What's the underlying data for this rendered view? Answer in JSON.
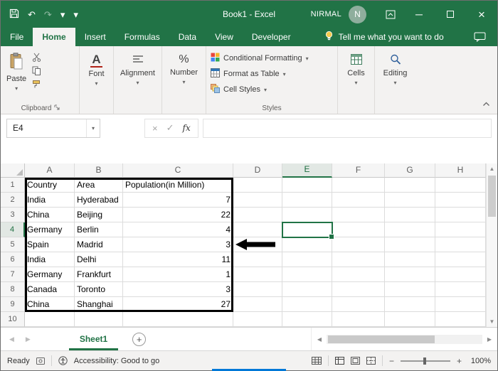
{
  "titlebar": {
    "title": "Book1 - Excel",
    "user_name": "NIRMAL",
    "avatar_initial": "N"
  },
  "tabs": [
    "File",
    "Home",
    "Insert",
    "Formulas",
    "Data",
    "View",
    "Developer"
  ],
  "tell_me_label": "Tell me what you want to do",
  "ribbon": {
    "paste_label": "Paste",
    "clipboard_group_label": "Clipboard",
    "font_label": "Font",
    "alignment_label": "Alignment",
    "number_label": "Number",
    "conditional_formatting_label": "Conditional Formatting",
    "format_as_table_label": "Format as Table",
    "cell_styles_label": "Cell Styles",
    "styles_group_label": "Styles",
    "cells_label": "Cells",
    "editing_label": "Editing"
  },
  "formula_bar": {
    "name_box_value": "E4",
    "fx_label": "fx",
    "formula_value": ""
  },
  "grid": {
    "column_headers": [
      "A",
      "B",
      "C",
      "D",
      "E",
      "F",
      "G",
      "H"
    ],
    "selected_cell": "E4",
    "selected_column": "E",
    "selected_row": 4,
    "row_count": 10,
    "table": {
      "headers": [
        "Country",
        "Area",
        "Population(in Million)"
      ],
      "rows": [
        [
          "India",
          "Hyderabad",
          7
        ],
        [
          "China",
          "Beijing",
          22
        ],
        [
          "Germany",
          "Berlin",
          4
        ],
        [
          "Spain",
          "Madrid",
          3
        ],
        [
          "India",
          "Delhi",
          11
        ],
        [
          "Germany",
          "Frankfurt",
          1
        ],
        [
          "Canada",
          "Toronto",
          3
        ],
        [
          "China",
          "Shanghai",
          27
        ]
      ]
    }
  },
  "sheet_bar": {
    "active_sheet": "Sheet1"
  },
  "status_bar": {
    "mode": "Ready",
    "accessibility": "Accessibility: Good to go",
    "zoom": "100%"
  },
  "glyphs": {
    "undo": "↶",
    "redo": "↷",
    "chevron_down": "▾",
    "minimize": "─",
    "close": "×",
    "cancel": "×",
    "check": "✓",
    "plus": "+",
    "minus": "−",
    "up": "▲",
    "down": "▼",
    "left": "◀",
    "right": "▶"
  },
  "colors": {
    "excel_green": "#217346",
    "selection": "#217346",
    "table_border": "#000000",
    "arrow": "#000000",
    "accent_line": "#0078D7"
  }
}
